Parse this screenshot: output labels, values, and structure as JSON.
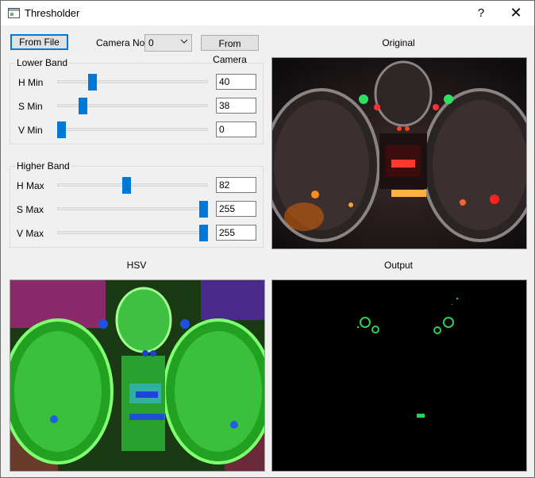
{
  "window": {
    "title": "Thresholder",
    "help_label": "?",
    "close_label": "✕"
  },
  "controls": {
    "from_file_label": "From File",
    "camera_no_label": "Camera No:",
    "camera_no_value": "0",
    "from_camera_label": "From Camera"
  },
  "lower_band": {
    "title": "Lower Band",
    "rows": [
      {
        "label": "H Min",
        "value": "40",
        "fraction": 0.22
      },
      {
        "label": "S Min",
        "value": "38",
        "fraction": 0.15
      },
      {
        "label": "V Min",
        "value": "0",
        "fraction": 0.0
      }
    ]
  },
  "higher_band": {
    "title": "Higher Band",
    "rows": [
      {
        "label": "H Max",
        "value": "82",
        "fraction": 0.46
      },
      {
        "label": "S Max",
        "value": "255",
        "fraction": 1.0
      },
      {
        "label": "V Max",
        "value": "255",
        "fraction": 1.0
      }
    ]
  },
  "panels": {
    "original": "Original",
    "hsv": "HSV",
    "output": "Output"
  },
  "icons": {
    "window": "app-icon",
    "combo": "chevron-down-icon"
  },
  "colors": {
    "accent": "#0078d7"
  }
}
